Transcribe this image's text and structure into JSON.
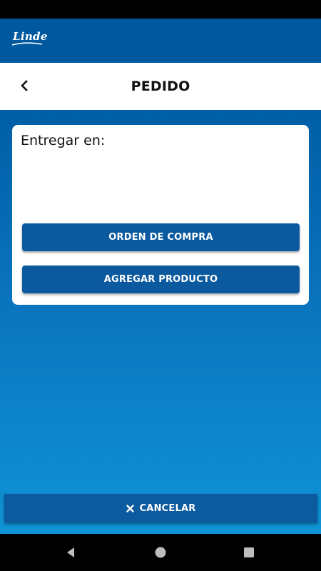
{
  "app": {
    "logo_text": "Linde",
    "brand_color": "#00599f"
  },
  "title_bar": {
    "title": "PEDIDO",
    "back_icon": "chevron-left-icon"
  },
  "card": {
    "deliver_label": "Entregar en:",
    "order_button_label": "ORDEN DE COMPRA",
    "add_product_button_label": "AGREGAR PRODUCTO"
  },
  "footer": {
    "cancel_label": "CANCELAR",
    "cancel_icon": "close-icon"
  },
  "nav": {
    "back_icon": "triangle-back-icon",
    "home_icon": "circle-home-icon",
    "recents_icon": "square-recents-icon"
  }
}
